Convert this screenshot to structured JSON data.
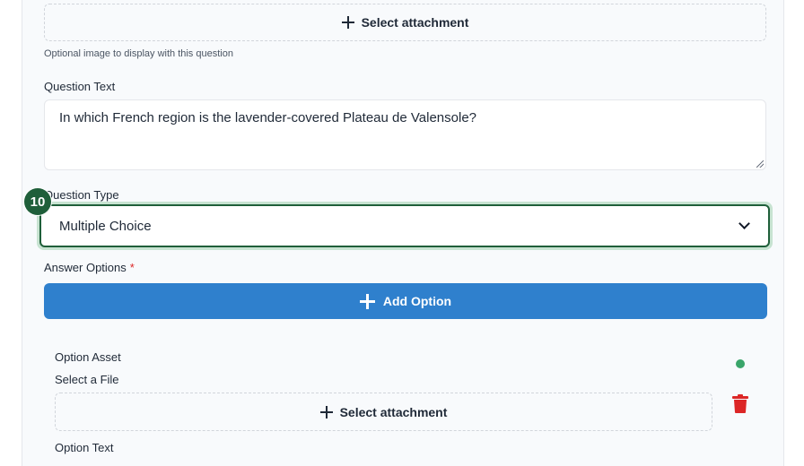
{
  "top_attachment": {
    "label": "Select attachment",
    "hint": "Optional image to display with this question"
  },
  "question_text": {
    "label": "Question Text",
    "value": "In which French region is the lavender-covered Plateau de Valensole?"
  },
  "question_type": {
    "label": "Question Type",
    "value": "Multiple Choice",
    "step_badge": "10"
  },
  "answer_options": {
    "label": "Answer Options",
    "required_mark": "*",
    "add_label": "Add Option"
  },
  "option": {
    "asset_label": "Option Asset",
    "select_file_label": "Select a File",
    "attachment_label": "Select attachment",
    "text_label": "Option Text"
  },
  "colors": {
    "accent_blue": "#2f80cd",
    "focus_green": "#1f5f3a",
    "status_green": "#3aa56a",
    "danger_red": "#dc2626"
  },
  "icons": [
    "plus-icon",
    "chevron-down-icon",
    "trash-icon",
    "status-dot"
  ]
}
